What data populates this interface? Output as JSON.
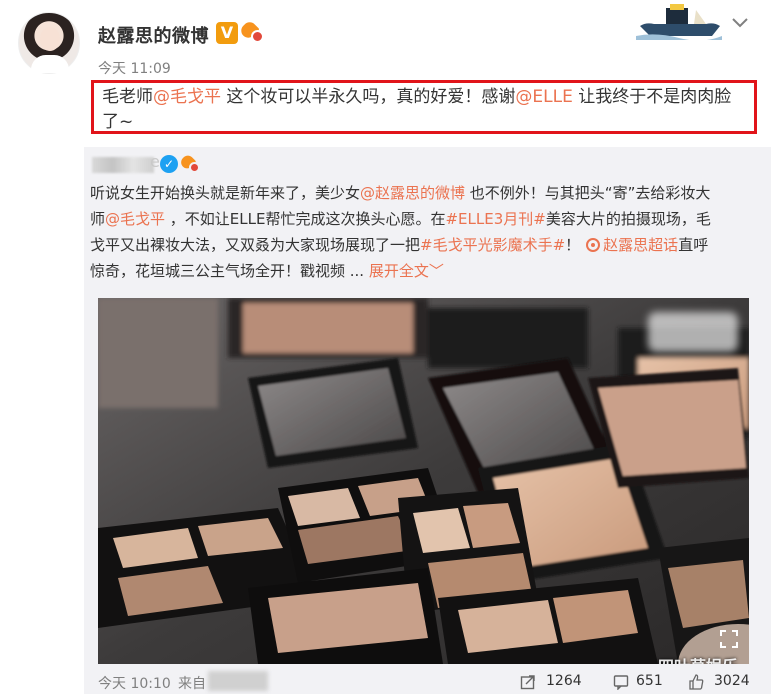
{
  "post": {
    "username": "赵露思的微博",
    "verified_badge": "V",
    "timestamp": "今天 11:09",
    "text_segments": [
      {
        "text": "毛老师",
        "mention": false
      },
      {
        "text": "@毛戈平",
        "mention": true
      },
      {
        "text": " 这个妆可以半永久吗，真的好爱！感谢",
        "mention": false
      },
      {
        "text": "@ELLE",
        "mention": true
      },
      {
        "text": " 让我终于不是肉肉脸了~",
        "mention": false
      }
    ]
  },
  "repost": {
    "author_tail": "e",
    "verified_badge": "✓",
    "text": {
      "l1a": "听说女生开始换头就是新年来了，美少女",
      "l1b": "@赵露思的微博",
      "l1c": " 也不例外！与其把头“寄”去给彩妆大",
      "l2a": "师",
      "l2b": "@毛戈平",
      "l2c": " ，不如让ELLE帮忙完成这次换头心愿。在",
      "l2d": "#ELLE3月刊#",
      "l2e": "美容大片的拍摄现场，毛",
      "l3a": "戈平又出裸妆大法，又双叒为大家现场展现了一把",
      "l3b": "#毛戈平光影魔术手#",
      "l3c": "！",
      "l3d": "赵露思超话",
      "l3e": "直呼",
      "l4a": "惊奇，花垣城三公主气场全开！戳视频 ... ",
      "l4b": "展开全文",
      "l4c": "﹀"
    }
  },
  "video": {
    "corner_watermark": "四叶草娱乐"
  },
  "footer": {
    "time": "今天 10:10",
    "source_prefix": "来自",
    "reposts": "1264",
    "comments": "651",
    "likes": "3024"
  },
  "icons": {
    "share": "share-icon",
    "comment": "comment-icon",
    "like": "like-icon",
    "menu": "chevron-down-icon",
    "fullscreen": "fullscreen-icon"
  },
  "colors": {
    "mention": "#eb7350",
    "highlight_border": "#e1141a",
    "repost_bg": "#f2f2f5"
  }
}
